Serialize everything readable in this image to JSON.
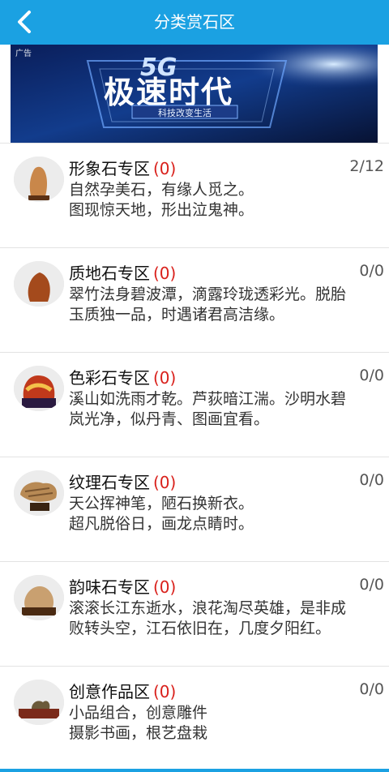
{
  "header": {
    "title": "分类赏石区"
  },
  "banner": {
    "ad_label": "广告",
    "brand": "5G",
    "headline": "极速时代",
    "slogan": "科技改变生活"
  },
  "categories": [
    {
      "name": "形象石专区",
      "count": "(0)",
      "ratio": "2/12",
      "line1": "自然孕美石，有缘人觅之。",
      "line2": "图现惊天地，形出泣鬼神。"
    },
    {
      "name": "质地石专区",
      "count": "(0)",
      "ratio": "0/0",
      "line1": "翠竹法身碧波潭，滴露玲珑透彩光。脱胎",
      "line2": "玉质独一品，时遇诸君高洁缘。"
    },
    {
      "name": "色彩石专区",
      "count": "(0)",
      "ratio": "0/0",
      "line1": "溪山如洗雨才乾。芦荻暗江湍。沙明水碧",
      "line2": "岚光净，似丹青、图画宜看。"
    },
    {
      "name": "纹理石专区",
      "count": "(0)",
      "ratio": "0/0",
      "line1": "天公挥神笔，陋石换新衣。",
      "line2": "超凡脱俗日，画龙点睛时。"
    },
    {
      "name": "韵味石专区",
      "count": "(0)",
      "ratio": "0/0",
      "line1": "滚滚长江东逝水，浪花淘尽英雄，是非成",
      "line2": "败转头空，江石依旧在，几度夕阳红。"
    },
    {
      "name": "创意作品区",
      "count": "(0)",
      "ratio": "0/0",
      "line1": "小品组合，创意雕件",
      "line2": "摄影书画，根艺盘栽"
    }
  ],
  "colors": {
    "header": "#1ba1e2",
    "count": "#d9201b"
  }
}
